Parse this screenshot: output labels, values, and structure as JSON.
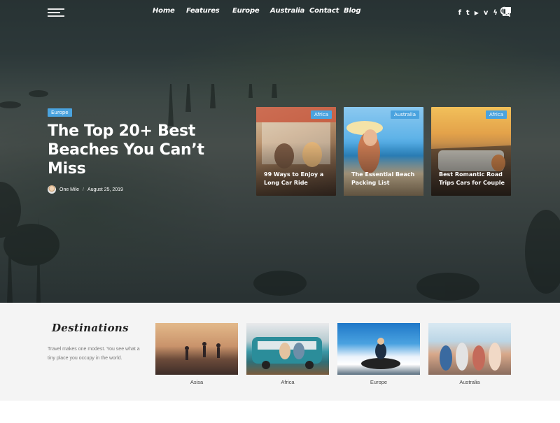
{
  "nav": {
    "menu": [
      "Home",
      "Features",
      "Europe",
      "Australia",
      "Contact",
      "Blog"
    ],
    "social_icons": [
      "facebook-icon",
      "twitter-icon",
      "youtube-icon",
      "vimeo-icon",
      "lightning-icon",
      "page-icon",
      "search-icon"
    ],
    "social_glyphs": [
      "f",
      "t",
      "▶",
      "v",
      "ϟ",
      "▮",
      ""
    ]
  },
  "hero": {
    "tag": "Europe",
    "title": "The Top 20+ Best Beaches You Can’t Miss",
    "author": "One Mile",
    "date": "August 25, 2019"
  },
  "cards": [
    {
      "tag": "Africa",
      "title": "99 Ways to Enjoy a Long Car Ride"
    },
    {
      "tag": "Australia",
      "title": "The Essential Beach Packing List"
    },
    {
      "tag": "Africa",
      "title": "Best Romantic Road Trips Cars for Couple"
    }
  ],
  "destinations": {
    "title": "Destinations",
    "description": "Travel makes one modest. You see what a tiny place you occupy in the world.",
    "items": [
      "Asisa",
      "Africa",
      "Europe",
      "Australia"
    ]
  },
  "colors": {
    "accent": "#4aa3df"
  }
}
